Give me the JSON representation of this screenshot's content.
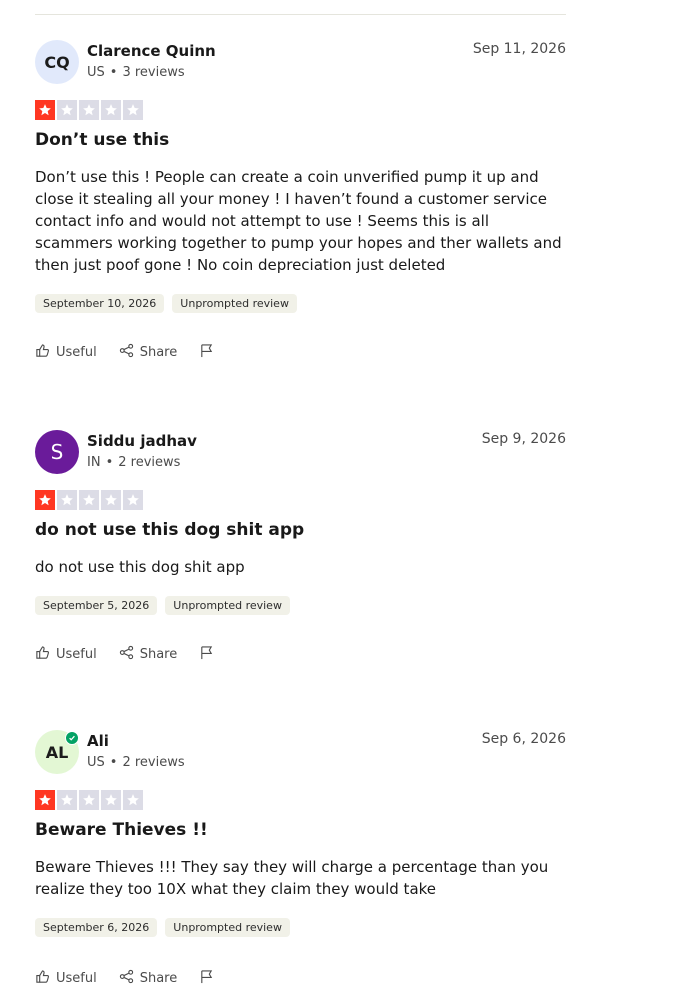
{
  "reviews": [
    {
      "initials": "CQ",
      "avatar_bg": "#e1e9fb",
      "avatar_fg": "#1c1c1c",
      "verified": false,
      "name": "Clarence Quinn",
      "country": "US",
      "review_count": "3 reviews",
      "date": "Sep 11, 2026",
      "rating": 1,
      "title": "Don’t use this",
      "body": "Don’t use this ! People can create a coin unverified pump it up and close it stealing all your money ! I haven’t found a customer service contact info and would not attempt to use ! Seems this is all scammers working together to pump your hopes and ther wallets and then just poof gone ! No coin depreciation just deleted",
      "experience_date": "September 10, 2026",
      "review_type": "Unprompted review"
    },
    {
      "initials": "S",
      "avatar_bg": "#6a1b9a",
      "avatar_fg": "#ffffff",
      "verified": false,
      "name": "Siddu jadhav",
      "country": "IN",
      "review_count": "2 reviews",
      "date": "Sep 9, 2026",
      "rating": 1,
      "title": "do not use this dog shit app",
      "body": "do not use this dog shit app",
      "experience_date": "September 5, 2026",
      "review_type": "Unprompted review"
    },
    {
      "initials": "AL",
      "avatar_bg": "#e3f7d4",
      "avatar_fg": "#1c1c1c",
      "verified": true,
      "name": "Ali",
      "country": "US",
      "review_count": "2 reviews",
      "date": "Sep 6, 2026",
      "rating": 1,
      "title": "Beware Thieves !!",
      "body": "Beware Thieves !!! They say they will charge a percentage than you realize they too 10X what they claim they would take",
      "experience_date": "September 6, 2026",
      "review_type": "Unprompted review"
    }
  ],
  "actions": {
    "useful_label": "Useful",
    "share_label": "Share",
    "useful_icon": "thumbs-up-icon",
    "share_icon": "share-icon",
    "report_icon": "flag-icon"
  },
  "colors": {
    "star_filled": "#ff3722",
    "star_empty": "#dcdce6",
    "verified": "#04a265"
  }
}
